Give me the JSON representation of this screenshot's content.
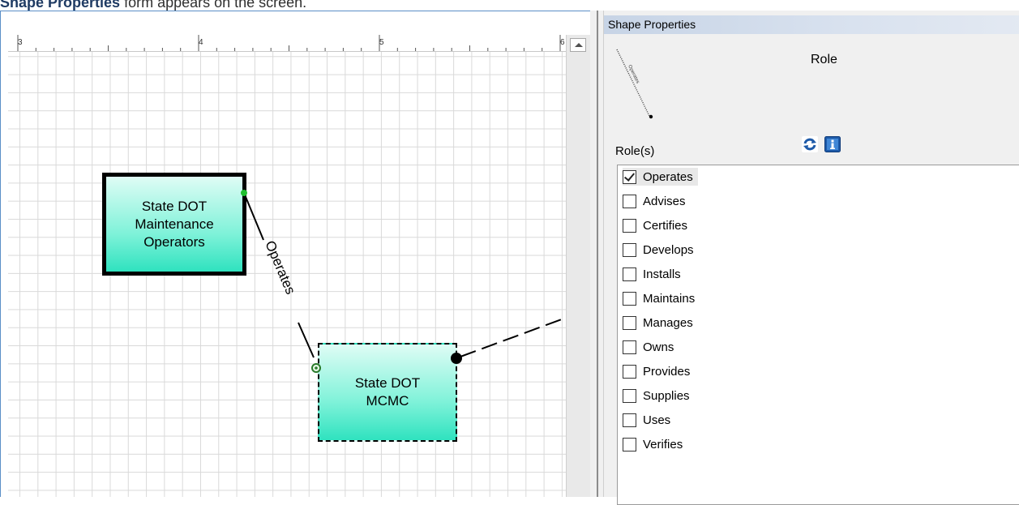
{
  "caption": {
    "bold": "Shape Properties",
    "rest": " form appears on the screen."
  },
  "ruler": {
    "marks": [
      "3",
      "4",
      "5",
      "6"
    ]
  },
  "diagram": {
    "shape_a": {
      "lines": [
        "State DOT",
        "Maintenance",
        "Operators"
      ]
    },
    "shape_b": {
      "lines": [
        "State DOT",
        "MCMC"
      ]
    },
    "connector_label": "Operates"
  },
  "panel": {
    "title": "Shape Properties",
    "preview_label": "Operates",
    "role_heading": "Role",
    "roles_label": "Role(s)",
    "roles": [
      {
        "label": "Operates",
        "checked": true
      },
      {
        "label": "Advises",
        "checked": false
      },
      {
        "label": "Certifies",
        "checked": false
      },
      {
        "label": "Develops",
        "checked": false
      },
      {
        "label": "Installs",
        "checked": false
      },
      {
        "label": "Maintains",
        "checked": false
      },
      {
        "label": "Manages",
        "checked": false
      },
      {
        "label": "Owns",
        "checked": false
      },
      {
        "label": "Provides",
        "checked": false
      },
      {
        "label": "Supplies",
        "checked": false
      },
      {
        "label": "Uses",
        "checked": false
      },
      {
        "label": "Verifies",
        "checked": false
      }
    ]
  },
  "icons": {
    "refresh": "refresh-icon",
    "info": "info-icon",
    "scroll_up": "chevron-up-icon"
  },
  "colors": {
    "shape_fill_top": "#dffcf5",
    "shape_fill_bottom": "#2fe2bf",
    "panel_title": "#c7d4e6",
    "icon_blue": "#1e5aa8"
  }
}
